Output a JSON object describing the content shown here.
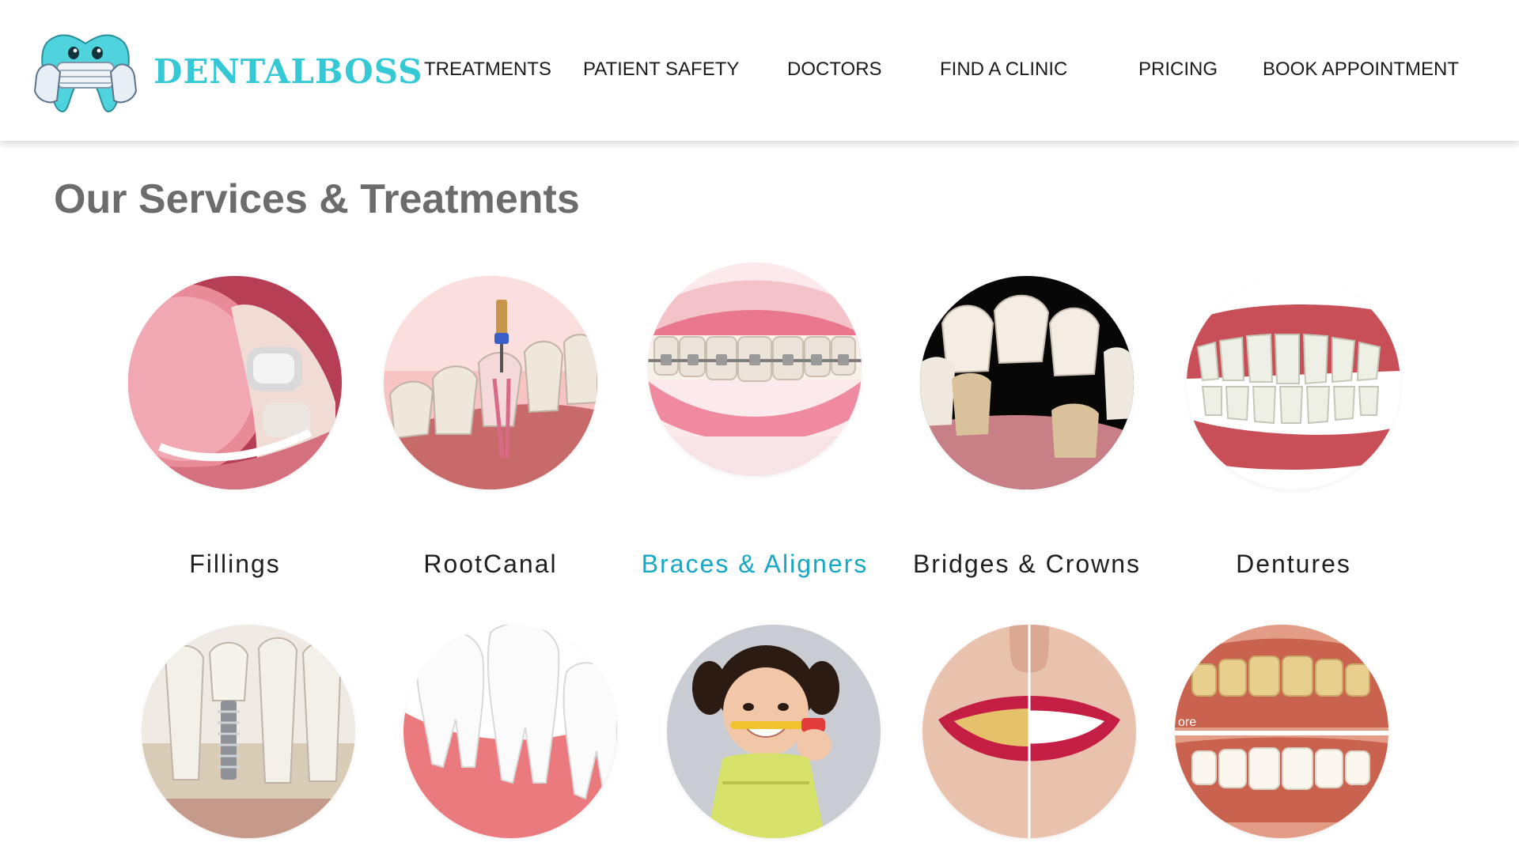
{
  "brand": {
    "name": "DENTALBOSS",
    "color": "#35c9d6",
    "logo_icon": "masked-tooth-icon"
  },
  "nav": {
    "items": [
      {
        "label": "TREATMENTS"
      },
      {
        "label": "PATIENT SAFETY"
      },
      {
        "label": "DOCTORS"
      },
      {
        "label": "FIND A CLINIC"
      },
      {
        "label": "PRICING"
      },
      {
        "label": "BOOK APPOINTMENT"
      }
    ]
  },
  "section": {
    "title": "Our Services & Treatments",
    "accent_color": "#17a8c3",
    "treatments": [
      {
        "label": "Fillings",
        "image": "filling-molar-photo"
      },
      {
        "label": "RootCanal",
        "image": "root-canal-illustration"
      },
      {
        "label": "Braces & Aligners",
        "image": "braces-smile-photo",
        "active": true
      },
      {
        "label": "Bridges & Crowns",
        "image": "dental-bridge-illustration"
      },
      {
        "label": "Dentures",
        "image": "denture-photo"
      },
      {
        "label": "",
        "image": "dental-implant-illustration"
      },
      {
        "label": "",
        "image": "wisdom-tooth-illustration"
      },
      {
        "label": "",
        "image": "child-toothbrush-photo"
      },
      {
        "label": "",
        "image": "teeth-whitening-photo"
      },
      {
        "label": "",
        "image": "before-after-smile-photo",
        "overlay_text": "ore"
      }
    ]
  }
}
